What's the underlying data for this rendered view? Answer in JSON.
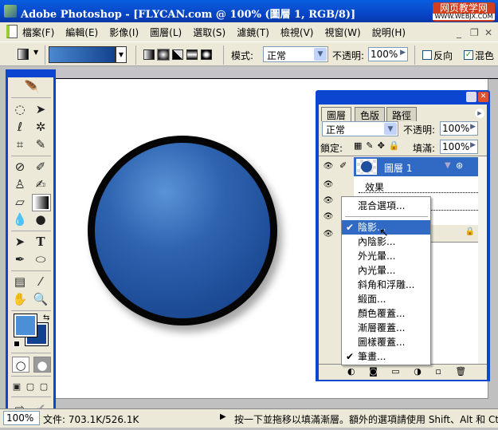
{
  "window": {
    "title": "Adobe Photoshop - [FLYCAN.com @ 100% (圖層 1, RGB/8)]",
    "watermark": "网页教学网",
    "watermark_sub": "WWW.WEBJX.COM"
  },
  "menu": [
    "檔案(F)",
    "編輯(E)",
    "影像(I)",
    "圖層(L)",
    "選取(S)",
    "濾鏡(T)",
    "檢視(V)",
    "視窗(W)",
    "說明(H)"
  ],
  "options": {
    "mode_label": "模式:",
    "mode_value": "正常",
    "opacity_label": "不透明:",
    "opacity_value": "100%",
    "reverse_label": "反向",
    "reverse_checked": false,
    "dither_label": "混色",
    "dither_checked": true,
    "gradient_colors": [
      "#4b88d0",
      "#12428e"
    ]
  },
  "tools": {
    "foreground": "#4b8fd6",
    "background": "#12428e"
  },
  "layers_panel": {
    "tabs": [
      "圖層",
      "色版",
      "路徑"
    ],
    "blend_mode": "正常",
    "opacity_label": "不透明:",
    "opacity_value": "100%",
    "lock_label": "鎖定:",
    "fill_label": "填滿:",
    "fill_value": "100%",
    "layer_name": "圖層 1",
    "effects_label": "效果"
  },
  "context_menu": {
    "items": [
      {
        "label": "混合選項...",
        "checked": false
      },
      {
        "label": "陰影...",
        "checked": true,
        "selected": true
      },
      {
        "label": "內陰影...",
        "checked": false
      },
      {
        "label": "外光暈...",
        "checked": false
      },
      {
        "label": "內光暈...",
        "checked": false
      },
      {
        "label": "斜角和浮雕...",
        "checked": false
      },
      {
        "label": "緞面...",
        "checked": false
      },
      {
        "label": "顏色覆蓋...",
        "checked": false
      },
      {
        "label": "漸層覆蓋...",
        "checked": false
      },
      {
        "label": "圖樣覆蓋...",
        "checked": false
      },
      {
        "label": "筆畫...",
        "checked": true
      }
    ]
  },
  "status": {
    "zoom": "100%",
    "doc": "文件: 703.1K/526.1K",
    "hint": "按一下並拖移以填滿漸層。額外的選項請使用 Shift、Alt 和 Ctrl"
  }
}
